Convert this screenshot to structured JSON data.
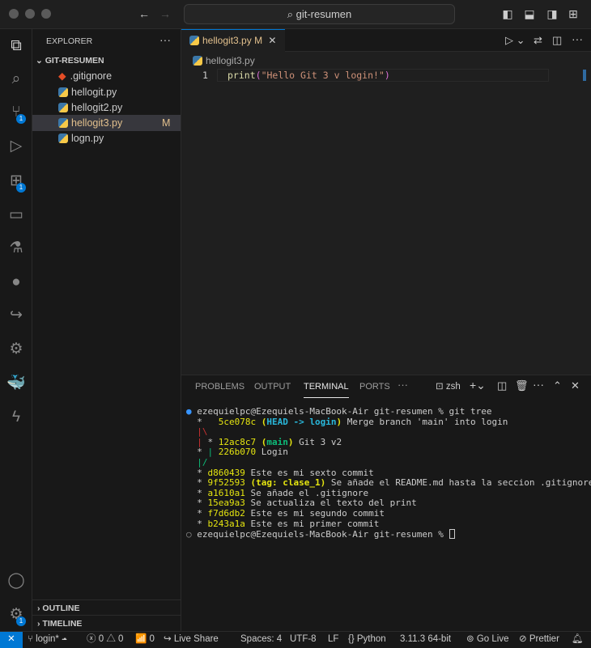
{
  "title": {
    "search": "git-resumen"
  },
  "activity": {
    "scm_badge": "1",
    "extensions_badge": "1",
    "settings_badge": "1"
  },
  "sidebar": {
    "title": "EXPLORER",
    "folder": "GIT-RESUMEN",
    "files": [
      {
        "name": ".gitignore",
        "type": "git",
        "status": ""
      },
      {
        "name": "hellogit.py",
        "type": "py",
        "status": ""
      },
      {
        "name": "hellogit2.py",
        "type": "py",
        "status": ""
      },
      {
        "name": "hellogit3.py",
        "type": "py",
        "status": "M"
      },
      {
        "name": "logn.py",
        "type": "py",
        "status": ""
      }
    ],
    "outline": "OUTLINE",
    "timeline": "TIMELINE"
  },
  "editor": {
    "tab": "hellogit3.py",
    "tab_status": "M",
    "breadcrumb": "hellogit3.py",
    "line_number": "1",
    "code_fn": "print",
    "code_str": "\"Hello Git 3 v login!\""
  },
  "panel": {
    "tabs": [
      "PROBLEMS",
      "OUTPUT",
      "TERMINAL",
      "PORTS"
    ],
    "shell": "zsh"
  },
  "terminal": {
    "prompt": "ezequielpc@Ezequiels-MacBook-Air git-resumen % ",
    "command": "git tree",
    "merge_hash": "5ce078c",
    "head": "HEAD -> login",
    "merge_msg": "Merge branch 'main' into login",
    "main_hash": "12ac8c7",
    "main_ref": "main",
    "main_msg": "Git 3 v2",
    "login_hash": "226b070",
    "login_msg": "Login",
    "commits": [
      {
        "hash": "d860439",
        "msg": "Este es mi sexto commit"
      },
      {
        "hash": "9f52593",
        "tag": "tag: clase_1",
        "msg": "Se añade el README.md hasta la seccion .gitignore"
      },
      {
        "hash": "a1610a1",
        "msg": "Se añade el .gitignore"
      },
      {
        "hash": "15ea9a3",
        "msg": "Se actualiza el texto del print"
      },
      {
        "hash": "f7d6db2",
        "msg": "Este es mi segundo commit"
      },
      {
        "hash": "b243a1a",
        "msg": "Este es mi primer commit"
      }
    ]
  },
  "status": {
    "branch": "login*",
    "errors": "0",
    "warnings": "0",
    "ports": "0",
    "live_share": "Live Share",
    "spaces": "Spaces: 4",
    "encoding": "UTF-8",
    "eol": "LF",
    "language": "Python",
    "interpreter": "3.11.3 64-bit",
    "go_live": "Go Live",
    "prettier": "Prettier"
  }
}
